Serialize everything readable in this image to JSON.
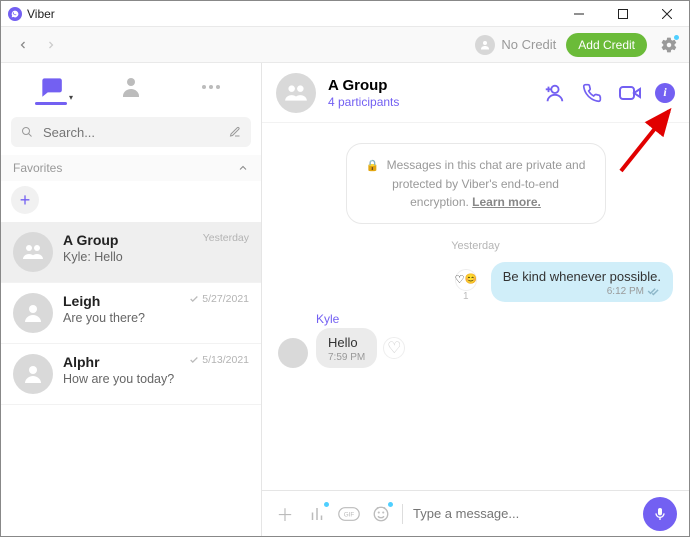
{
  "window": {
    "title": "Viber"
  },
  "toolbar": {
    "no_credit": "No Credit",
    "add_credit": "Add Credit"
  },
  "sidebar": {
    "search_placeholder": "Search...",
    "favorites_label": "Favorites",
    "chats": [
      {
        "name": "A Group",
        "preview": "Kyle: Hello",
        "time": "Yesterday",
        "checks": false,
        "active": true
      },
      {
        "name": "Leigh",
        "preview": "Are you there?",
        "time": "5/27/2021",
        "checks": true,
        "active": false
      },
      {
        "name": "Alphr",
        "preview": "How are you today?",
        "time": "5/13/2021",
        "checks": true,
        "active": false
      }
    ]
  },
  "chat": {
    "title": "A Group",
    "meta": "4 participants",
    "encryption_notice": "Messages in this chat are private and protected by Viber's end-to-end encryption.",
    "learn_more": "Learn more.",
    "day_separator": "Yesterday",
    "outgoing": {
      "text": "Be kind whenever possible.",
      "time": "6:12 PM",
      "reaction_emoji": "😊",
      "reaction_count": "1"
    },
    "incoming": {
      "sender": "Kyle",
      "text": "Hello",
      "time": "7:59 PM"
    },
    "composer_placeholder": "Type a message..."
  }
}
